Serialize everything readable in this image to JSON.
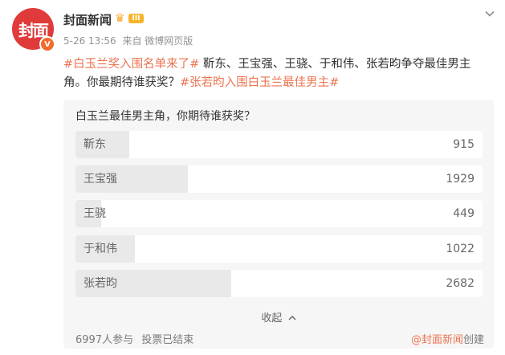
{
  "account": {
    "avatar_text": "封面",
    "verify_badge": "V",
    "name": "封面新闻",
    "level_badge": "III",
    "date": "5-26 13:56",
    "source": "来自 微博网页版"
  },
  "post": {
    "tag1": "#白玉兰奖入围名单来了#",
    "body": " 靳东、王宝强、王骁、于和伟、张若昀争夺最佳男主角。你最期待谁获奖？",
    "tag2": "#张若昀入围白玉兰最佳男主#"
  },
  "poll": {
    "question": "白玉兰最佳男主角，你期待谁获奖？",
    "options": [
      {
        "label": "靳东",
        "count": 915,
        "count_text": "915",
        "share": 0.132
      },
      {
        "label": "王宝强",
        "count": 1929,
        "count_text": "1929",
        "share": 0.276
      },
      {
        "label": "王骁",
        "count": 449,
        "count_text": "449",
        "share": 0.064
      },
      {
        "label": "于和伟",
        "count": 1022,
        "count_text": "1022",
        "share": 0.146
      },
      {
        "label": "张若昀",
        "count": 2682,
        "count_text": "2682",
        "share": 0.383
      }
    ],
    "collapse_label": "收起",
    "participants": "6997人参与",
    "status": "投票已结束",
    "creator_link": "@封面新闻",
    "creator_suffix": "创建"
  },
  "colors": {
    "accent": "#eb7350",
    "avatar_bg": "#e03a3a",
    "bar_fill": "#e9e9e9",
    "panel_bg": "#f6f6f6"
  },
  "icons": [
    "verified-icon",
    "crown-icon",
    "chevron-down-icon",
    "chevron-up-icon"
  ]
}
